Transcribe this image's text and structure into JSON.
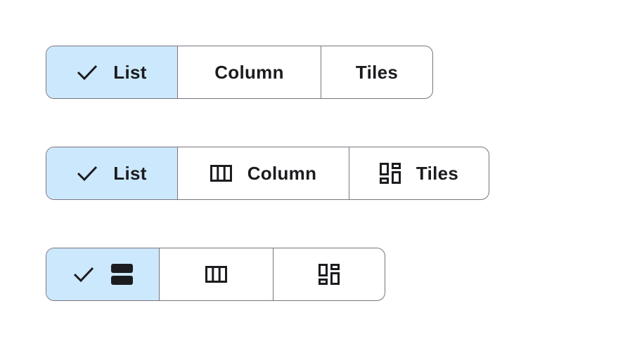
{
  "segmented_text": {
    "buttons": [
      {
        "label": "List",
        "selected": true,
        "icon": "check-icon"
      },
      {
        "label": "Column",
        "selected": false
      },
      {
        "label": "Tiles",
        "selected": false
      }
    ]
  },
  "segmented_icon_text": {
    "buttons": [
      {
        "label": "List",
        "selected": true,
        "icon": "check-icon"
      },
      {
        "label": "Column",
        "selected": false,
        "icon": "view-column-icon"
      },
      {
        "label": "Tiles",
        "selected": false,
        "icon": "view-tiles-icon"
      }
    ]
  },
  "segmented_icon_only": {
    "buttons": [
      {
        "selected": true,
        "icons": [
          "check-icon",
          "view-list-icon"
        ]
      },
      {
        "selected": false,
        "icon": "view-column-icon"
      },
      {
        "selected": false,
        "icon": "view-tiles-icon"
      }
    ]
  },
  "colors": {
    "selected_background": "#cce8fc",
    "outline": "#79747e",
    "text": "#1c1b1f"
  }
}
